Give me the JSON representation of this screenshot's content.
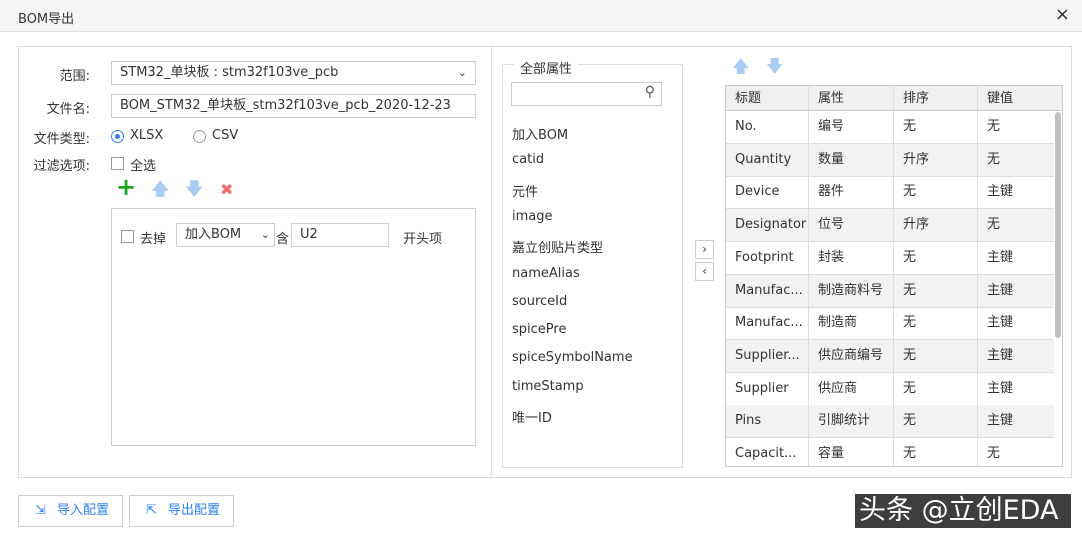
{
  "window": {
    "title": "BOM导出",
    "close_icon": "×"
  },
  "form": {
    "range_label": "范围:",
    "range_value": "STM32_单块板 : stm32f103ve_pcb",
    "filename_label": "文件名:",
    "filename_value": "BOM_STM32_单块板_stm32f103ve_pcb_2020-12-23",
    "filetype_label": "文件类型:",
    "filetype_options": [
      "XLSX",
      "CSV"
    ],
    "filetype_selected": "XLSX",
    "filter_label": "过滤选项:",
    "select_all_label": "全选"
  },
  "filter_toolbar": {
    "add_icon": "+",
    "up_icon": "🡅",
    "down_icon": "🡇",
    "delete_icon": "✖"
  },
  "filter_rule": {
    "remove_label": "去掉",
    "field_value": "加入BOM",
    "contains_label": "含",
    "text_value": "U2",
    "suffix_label": "开头项"
  },
  "attributes": {
    "legend": "全部属性",
    "search_placeholder": "",
    "items": [
      "加入BOM",
      "catid",
      "元件",
      "image",
      "嘉立创贴片类型",
      "nameAlias",
      "sourceId",
      "spicePre",
      "spiceSymbolName",
      "timeStamp",
      "唯一ID"
    ]
  },
  "transfer": {
    "right": "›",
    "left": "‹"
  },
  "table": {
    "headers": [
      "标题",
      "属性",
      "排序",
      "键值"
    ],
    "rows": [
      [
        "No.",
        "编号",
        "无",
        "无"
      ],
      [
        "Quantity",
        "数量",
        "升序",
        "无"
      ],
      [
        "Device",
        "器件",
        "无",
        "主键"
      ],
      [
        "Designator",
        "位号",
        "升序",
        "无"
      ],
      [
        "Footprint",
        "封装",
        "无",
        "主键"
      ],
      [
        "Manufac...",
        "制造商料号",
        "无",
        "主键"
      ],
      [
        "Manufac...",
        "制造商",
        "无",
        "主键"
      ],
      [
        "Supplier...",
        "供应商编号",
        "无",
        "主键"
      ],
      [
        "Supplier",
        "供应商",
        "无",
        "主键"
      ],
      [
        "Pins",
        "引脚统计",
        "无",
        "主键"
      ],
      [
        "Capacit...",
        "容量",
        "无",
        "无"
      ]
    ]
  },
  "footer": {
    "import_label": "导入配置",
    "export_label": "导出配置"
  },
  "watermark": "头条 @立创EDA",
  "colors": {
    "accent": "#2f80ed",
    "add_green": "#1ea31e",
    "delete_red": "#f07070",
    "arrow_disabled": "#a9cdf2"
  }
}
